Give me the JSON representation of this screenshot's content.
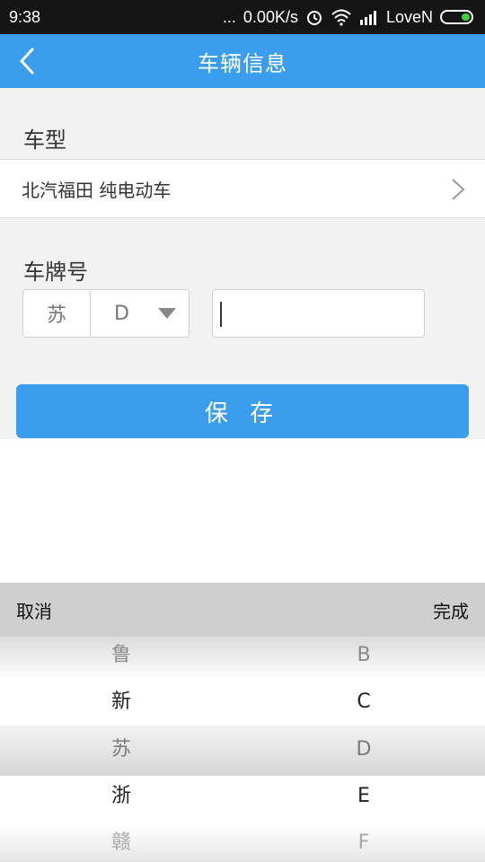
{
  "status_bar": {
    "time": "9:38",
    "dots": "...",
    "speed": "0.00K/s",
    "carrier": "LoveN"
  },
  "header": {
    "title": "车辆信息"
  },
  "vehicle_model": {
    "label": "车型",
    "value": "北汽福田 纯电动车"
  },
  "plate": {
    "label": "车牌号",
    "province": "苏",
    "letter": "D",
    "number_value": ""
  },
  "save_label": "保 存",
  "picker": {
    "cancel_label": "取消",
    "done_label": "完成",
    "left_items": [
      "鲁",
      "新",
      "苏",
      "浙",
      "赣"
    ],
    "right_items": [
      "B",
      "C",
      "D",
      "E",
      "F"
    ]
  },
  "colors": {
    "accent": "#3a9ded",
    "status_bar": "#151515",
    "page_bg": "#f2f2f2"
  }
}
